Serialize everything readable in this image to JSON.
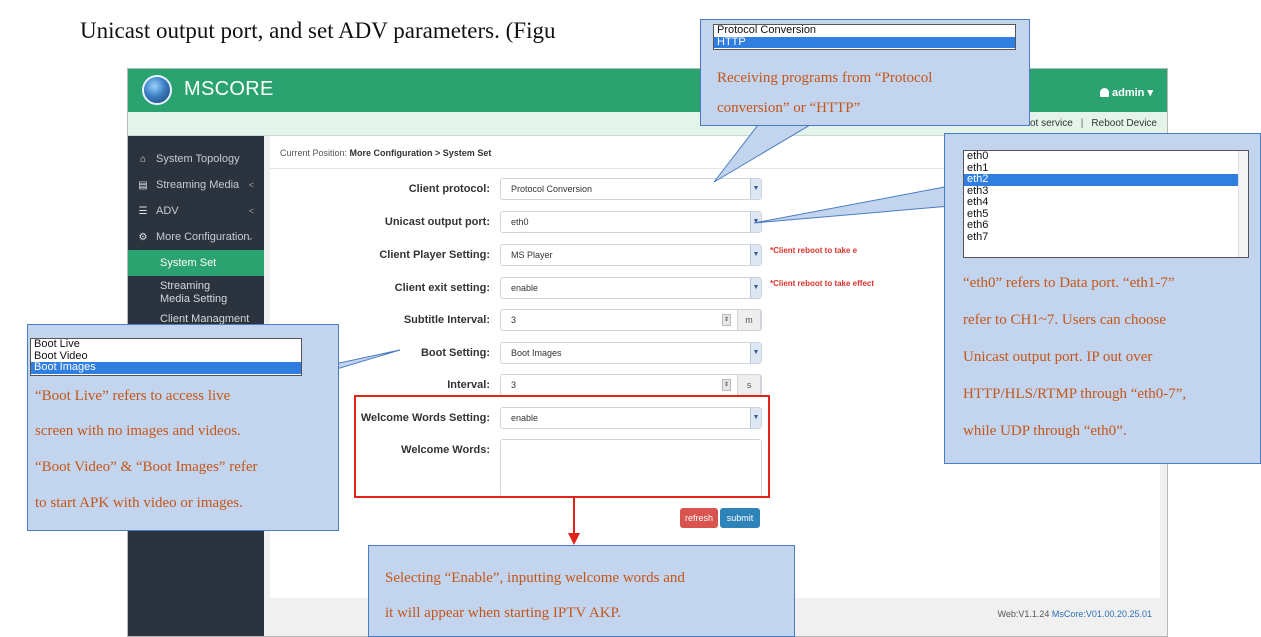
{
  "doc": {
    "line": "Unicast output port, and set ADV parameters. (Figu"
  },
  "app": {
    "brand": "MSCORE",
    "user": "admin",
    "user_caret": "▾",
    "subbar": {
      "reboot_service": "eboot service",
      "separator": "|",
      "reboot_device": "Reboot Device"
    },
    "sidebar": {
      "topology": "System Topology",
      "streaming": "Streaming Media",
      "adv": "ADV",
      "more_config": "More Configuration",
      "system_set": "System Set",
      "streaming_setting": "Streaming Media Setting",
      "client_mgmt": "Client Managment",
      "caret_left": "<",
      "caret_down": "⌄"
    },
    "breadcrumb": {
      "prefix": "Current Position:",
      "path": "More Configuration > System Set"
    },
    "form": {
      "client_protocol": {
        "label": "Client protocol:",
        "value": "Protocol Conversion"
      },
      "unicast_port": {
        "label": "Unicast output port:",
        "value": "eth0"
      },
      "player": {
        "label": "Client Player Setting:",
        "value": "MS Player",
        "note": "*Client reboot to take e"
      },
      "exit": {
        "label": "Client exit setting:",
        "value": "enable",
        "note": "*Client reboot to take effect"
      },
      "subtitle": {
        "label": "Subtitle Interval:",
        "value": "3",
        "unit": "m"
      },
      "boot": {
        "label": "Boot Setting:",
        "value": "Boot Images"
      },
      "interval": {
        "label": "Interval:",
        "value": "3",
        "unit": "s"
      },
      "welcome_setting": {
        "label": "Welcome Words Setting:",
        "value": "enable"
      },
      "welcome_words": {
        "label": "Welcome Words:",
        "value": ""
      }
    },
    "buttons": {
      "refresh": "refresh",
      "submit": "submit"
    },
    "footer": {
      "web": "Web:V1.1.24",
      "core": "MsCore:V01.00.20.25.01"
    }
  },
  "callouts": {
    "protocol": {
      "options": [
        "Protocol Conversion",
        "HTTP"
      ],
      "selected": "HTTP",
      "text_line1": "Receiving programs from “Protocol",
      "text_line2": "conversion” or “HTTP”"
    },
    "eth": {
      "options": [
        "eth0",
        "eth1",
        "eth2",
        "eth3",
        "eth4",
        "eth5",
        "eth6",
        "eth7"
      ],
      "selected": "eth2",
      "lines": [
        "“eth0” refers to Data port. “eth1-7”",
        "refer to CH1~7. Users can choose",
        "Unicast output port. IP out over",
        "HTTP/HLS/RTMP through “eth0-7”,",
        "while UDP through “eth0”."
      ]
    },
    "boot": {
      "options": [
        "Boot Live",
        "Boot Video",
        "Boot Images"
      ],
      "selected": "Boot Images",
      "lines": [
        "“Boot Live” refers to access live",
        "screen with no images and videos.",
        "“Boot Video” & “Boot Images” refer",
        "to start APK with video or images."
      ]
    },
    "welcome": {
      "lines": [
        "Selecting “Enable”, inputting welcome words and",
        "it will appear when starting IPTV AKP."
      ]
    }
  },
  "colors": {
    "header": "#2ba370",
    "sidebar": "#2b333e",
    "callout_bg": "#c3d5ee",
    "callout_text": "#c4561a",
    "highlight": "#e0241a"
  }
}
